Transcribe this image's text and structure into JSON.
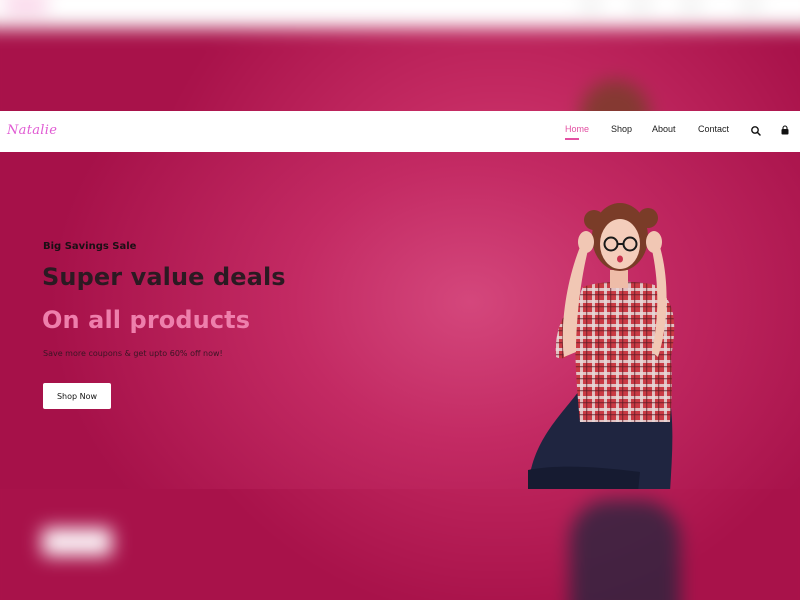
{
  "brand": {
    "logo": "Natalie"
  },
  "nav": {
    "items": [
      {
        "label": "Home",
        "active": true
      },
      {
        "label": "Shop",
        "active": false
      },
      {
        "label": "About",
        "active": false
      },
      {
        "label": "Contact",
        "active": false
      }
    ],
    "icons": [
      "search-icon",
      "shopping-bag-icon"
    ]
  },
  "hero": {
    "eyebrow": "Big Savings Sale",
    "title": "Super value deals",
    "subtitle": "On all products",
    "text": "Save more coupons & get upto 60% off now!",
    "button_label": "Shop Now"
  },
  "colors": {
    "accent": "#e34fa2",
    "hero_background": "#c32a63",
    "subtitle": "#ee7fac",
    "logo": "#e05ad3"
  }
}
